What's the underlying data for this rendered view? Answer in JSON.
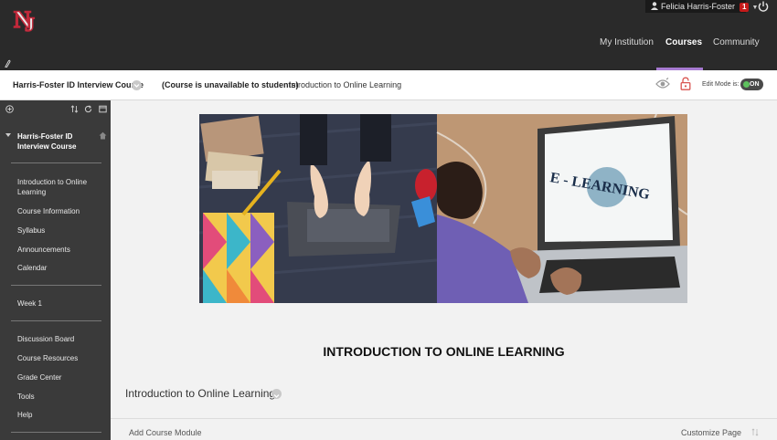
{
  "header": {
    "user_name": "Felicia Harris-Foster",
    "notification_count": "1",
    "nav": [
      "My Institution",
      "Courses",
      "Community"
    ],
    "active_tab": "Courses",
    "accent_color": "#a77ad1"
  },
  "breadcrumb": {
    "course": "Harris-Foster ID Interview Course",
    "status": "(Course is unavailable to students)",
    "page": "Introduction to Online Learning",
    "edit_mode_label": "Edit Mode is:",
    "edit_mode_value": "ON"
  },
  "sidebar": {
    "course_title": "Harris-Foster ID Interview Course",
    "group1": [
      "Introduction to Online Learning",
      "Course Information",
      "Syllabus",
      "Announcements",
      "Calendar"
    ],
    "group2": [
      "Week 1"
    ],
    "group3": [
      "Discussion Board",
      "Course Resources",
      "Grade Center",
      "Tools",
      "Help"
    ]
  },
  "main": {
    "banner_text": "E - LEARNING",
    "heading": "INTRODUCTION TO ONLINE LEARNING",
    "module_title": "Introduction to Online Learning",
    "add_module": "Add Course Module",
    "customize": "Customize Page"
  },
  "icons": [
    "logo-icon",
    "user-icon",
    "power-icon",
    "pin-icon",
    "chevron-down-icon",
    "eye-icon",
    "lock-icon",
    "add-icon",
    "sort-icon",
    "refresh-icon",
    "folder-icon",
    "home-icon"
  ]
}
